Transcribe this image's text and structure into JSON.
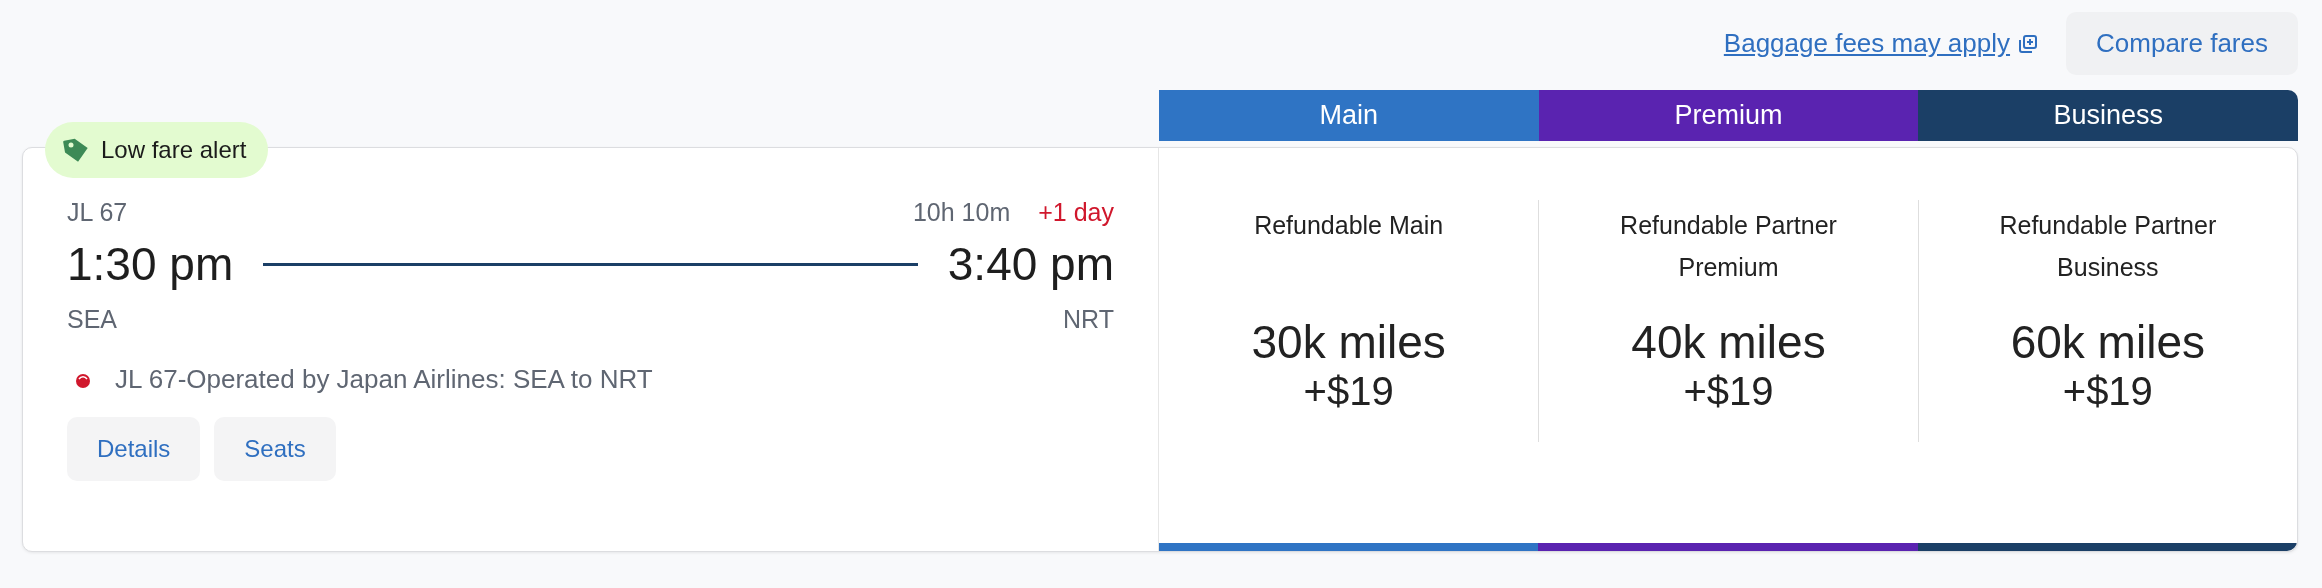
{
  "header": {
    "baggage_link": "Baggage fees may apply",
    "compare_button": "Compare fares"
  },
  "fare_tabs": [
    {
      "label": "Main",
      "color": "#2f74c4"
    },
    {
      "label": "Premium",
      "color": "#5a23b0"
    },
    {
      "label": "Business",
      "color": "#1b3f66"
    }
  ],
  "flight": {
    "badge": "Low fare alert",
    "flight_number": "JL 67",
    "duration": "10h 10m",
    "day_offset": "+1 day",
    "depart_time": "1:30 pm",
    "arrive_time": "3:40 pm",
    "origin": "SEA",
    "destination": "NRT",
    "operated_by": "JL 67-Operated by Japan Airlines: SEA to NRT",
    "buttons": [
      "Details",
      "Seats"
    ]
  },
  "fares": [
    {
      "name": "Refundable Main",
      "miles": "30k miles",
      "fee": "+$19"
    },
    {
      "name": "Refundable Partner Premium",
      "miles": "40k miles",
      "fee": "+$19"
    },
    {
      "name": "Refundable Partner Business",
      "miles": "60k miles",
      "fee": "+$19"
    }
  ]
}
